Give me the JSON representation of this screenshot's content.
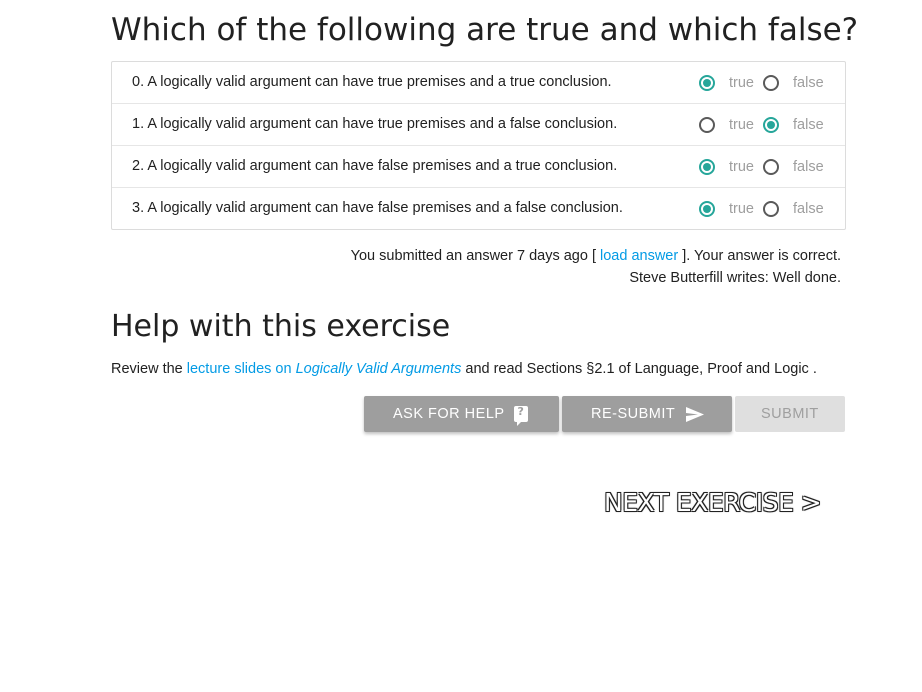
{
  "question": {
    "title": "Which of the following are true and which false?",
    "true_label": "true",
    "false_label": "false",
    "rows": [
      {
        "statement": "0. A logically valid argument can have true premises and a true conclusion.",
        "selected": "true"
      },
      {
        "statement": "1. A logically valid argument can have true premises and a false conclusion.",
        "selected": "false"
      },
      {
        "statement": "2. A logically valid argument can have false premises and a true conclusion.",
        "selected": "true"
      },
      {
        "statement": "3. A logically valid argument can have false premises and a false conclusion.",
        "selected": "true"
      }
    ]
  },
  "status": {
    "submitted_prefix": "You submitted an answer 7 days ago [",
    "load_answer": "load answer",
    "submitted_suffix": "]. Your answer is correct.",
    "feedback": "Steve Butterfill writes: Well done."
  },
  "help": {
    "title": "Help with this exercise",
    "review_prefix": "Review the",
    "link_prefix": "lecture slides on",
    "link_italic": "Logically Valid Arguments",
    "review_suffix": "and read Sections §2.1 of Language, Proof and Logic ."
  },
  "buttons": {
    "ask_for_help": "ASK FOR HELP",
    "resubmit": "RE-SUBMIT",
    "submit": "SUBMIT"
  },
  "next_exercise": "NEXT EXERCISE >",
  "colors": {
    "accent": "#26a69a",
    "link": "#039be5",
    "button_gray": "#9e9e9e",
    "button_disabled": "#dfdfdf"
  },
  "icons": {
    "help": "question-bubble-icon",
    "send": "send-icon"
  }
}
